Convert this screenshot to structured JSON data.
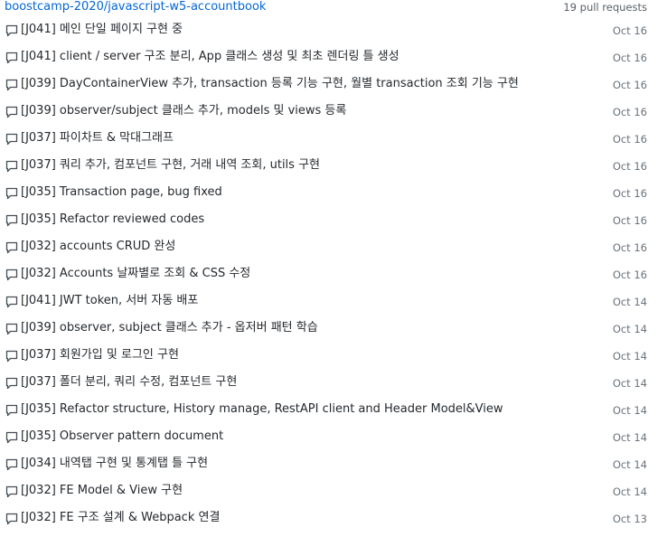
{
  "header": {
    "repo": "boostcamp-2020/javascript-w5-accountbook",
    "count": "19 pull requests"
  },
  "icon": "comment-icon",
  "pull_requests": [
    {
      "title": "[J041] 메인 단일 페이지 구현 중",
      "date": "Oct 16"
    },
    {
      "title": "[J041] client / server 구조 분리, App 클래스 생성 및 최초 렌더링 틀 생성",
      "date": "Oct 16"
    },
    {
      "title": "[J039] DayContainerView 추가, transaction 등록 기능 구현, 월별 transaction 조회 기능 구현",
      "date": "Oct 16"
    },
    {
      "title": "[J039] observer/subject 클래스 추가, models 및 views 등록",
      "date": "Oct 16"
    },
    {
      "title": "[J037] 파이차트 & 막대그래프",
      "date": "Oct 16"
    },
    {
      "title": "[J037] 쿼리 추가, 컴포넌트 구현, 거래 내역 조회, utils 구현",
      "date": "Oct 16"
    },
    {
      "title": "[J035] Transaction page, bug fixed",
      "date": "Oct 16"
    },
    {
      "title": "[J035] Refactor reviewed codes",
      "date": "Oct 16"
    },
    {
      "title": "[J032] accounts CRUD 완성",
      "date": "Oct 16"
    },
    {
      "title": "[J032] Accounts 날짜별로 조회 & CSS 수정",
      "date": "Oct 16"
    },
    {
      "title": "[J041] JWT token, 서버 자동 배포",
      "date": "Oct 14"
    },
    {
      "title": "[J039] observer, subject 클래스 추가 - 옵저버 패턴 학습",
      "date": "Oct 14"
    },
    {
      "title": "[J037] 회원가입 및 로그인 구현",
      "date": "Oct 14"
    },
    {
      "title": "[J037] 폴더 분리, 쿼리 수정, 컴포넌트 구현",
      "date": "Oct 14"
    },
    {
      "title": "[J035] Refactor structure, History manage, RestAPI client and Header Model&View",
      "date": "Oct 14"
    },
    {
      "title": "[J035] Observer pattern document",
      "date": "Oct 14"
    },
    {
      "title": "[J034] 내역탭 구현 및 통계탭 틀 구현",
      "date": "Oct 14"
    },
    {
      "title": "[J032] FE Model & View 구현",
      "date": "Oct 14"
    },
    {
      "title": "[J032] FE 구조 설계 & Webpack 연결",
      "date": "Oct 13"
    }
  ]
}
